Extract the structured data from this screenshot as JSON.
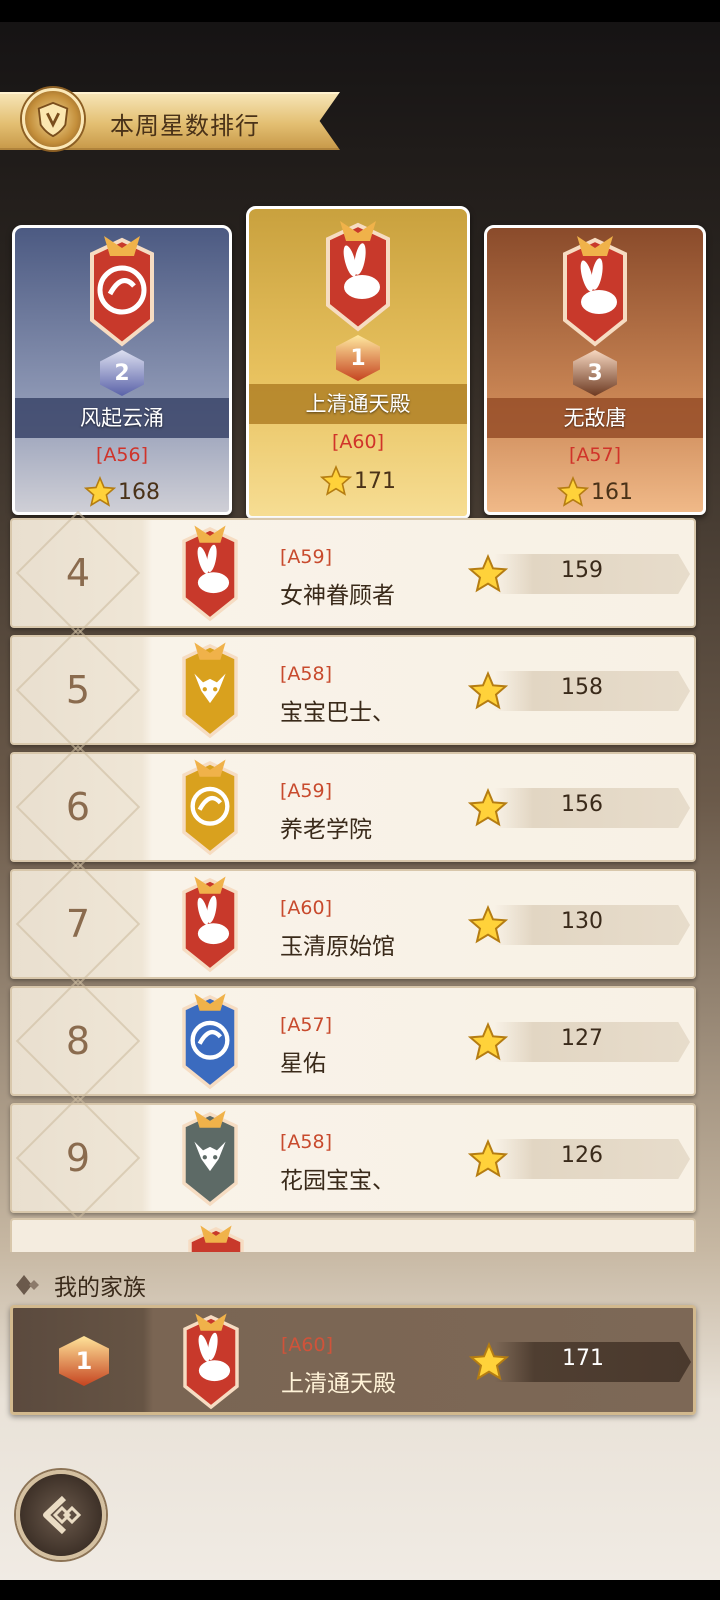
{
  "title": "本周星数排行",
  "top3": [
    {
      "rank": "2",
      "name": "风起云涌",
      "tag": "[A56]",
      "stars": "168",
      "crest": "dragon-crest-icon",
      "tier": "silver"
    },
    {
      "rank": "1",
      "name": "上清通天殿",
      "tag": "[A60]",
      "stars": "171",
      "crest": "rabbit-crest-icon",
      "tier": "gold"
    },
    {
      "rank": "3",
      "name": "无敌唐",
      "tag": "[A57]",
      "stars": "161",
      "crest": "rabbit-crest-icon",
      "tier": "bronze"
    }
  ],
  "list": [
    {
      "rank": "4",
      "tag": "[A59]",
      "name": "女神眷顾者",
      "stars": "159",
      "crest": "rabbit-crest-icon",
      "color": "#c8392b"
    },
    {
      "rank": "5",
      "tag": "[A58]",
      "name": "宝宝巴士、",
      "stars": "158",
      "crest": "fox-crest-icon",
      "color": "#d9a11e"
    },
    {
      "rank": "6",
      "tag": "[A59]",
      "name": "养老学院",
      "stars": "156",
      "crest": "dragon-crest-icon",
      "color": "#d9a11e"
    },
    {
      "rank": "7",
      "tag": "[A60]",
      "name": "玉清原始馆",
      "stars": "130",
      "crest": "rabbit-crest-icon",
      "color": "#c8392b"
    },
    {
      "rank": "8",
      "tag": "[A57]",
      "name": "星佑",
      "stars": "127",
      "crest": "dragon-crest-icon",
      "color": "#3b6bbf"
    },
    {
      "rank": "9",
      "tag": "[A58]",
      "name": "花园宝宝、",
      "stars": "126",
      "crest": "fox-crest-icon",
      "color": "#5d6a66"
    }
  ],
  "my_family": {
    "header": "我的家族",
    "rank": "1",
    "tag": "[A60]",
    "name": "上清通天殿",
    "stars": "171"
  }
}
